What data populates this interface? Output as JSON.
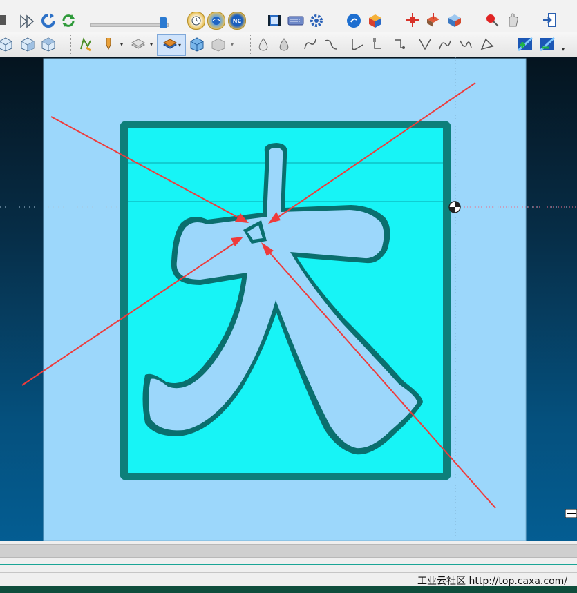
{
  "toolbar_top": {
    "slider": {
      "level": 0.95
    },
    "buttons": [
      "stop-button",
      "fast-forward-button",
      "refresh-button",
      "reload-button",
      "clock-button",
      "globe-button",
      "nc-button",
      "film-button",
      "keyboard-button",
      "settings-gear-button",
      "arrow-circle-button",
      "cube-color-button",
      "crosshair-button",
      "machine-button",
      "cube-tool-button",
      "pin-button",
      "hand-button",
      "exit-button"
    ],
    "nc_label": "NC"
  },
  "toolbar_second": {
    "groups": [
      "view-cubes",
      "operations",
      "paths",
      "simulation"
    ]
  },
  "viewport": {
    "stock_color": "#17f4f6",
    "part_color": "#9cd7fb",
    "wall_color": "#0d7f7a",
    "character": "大",
    "arrow_color": "#ef3b3b"
  },
  "watermark": "工业云社区 http://top.caxa.com/"
}
